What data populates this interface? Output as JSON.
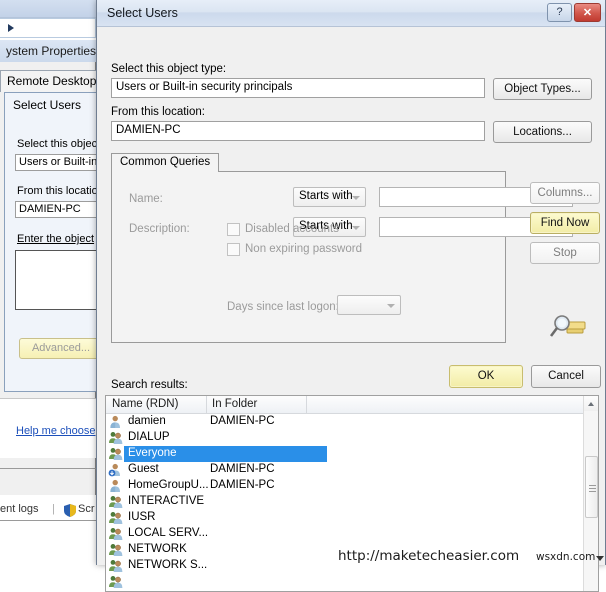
{
  "background": {
    "system_properties_title": "ystem Properties",
    "tab_label": "Remote Desktop",
    "inner_dialog_title": "Select Users",
    "label_object_type": "Select this objec",
    "value_object_type": "Users or Built-in",
    "label_location": "From this location",
    "value_location": "DAMIEN-PC",
    "label_enter_object": "Enter the object",
    "value_enter_object": "",
    "advanced_button": "Advanced...",
    "help_link": "Help me choose",
    "status_text": "ent logs",
    "status_text2": "Scr",
    "shield_icon": "shield-icon"
  },
  "dialog": {
    "title": "Select Users",
    "help_button": "?",
    "close_button": "✕",
    "object_type": {
      "label": "Select this object type:",
      "value": "Users or Built-in security principals",
      "button": "Object Types..."
    },
    "location": {
      "label": "From this location:",
      "value": "DAMIEN-PC",
      "button": "Locations..."
    },
    "tab": {
      "label": "Common Queries"
    },
    "query": {
      "name_label": "Name:",
      "name_operator": "Starts with",
      "name_value": "",
      "description_label": "Description:",
      "description_operator": "Starts with",
      "description_value": "",
      "disabled_accounts_label": "Disabled accounts",
      "disabled_accounts_checked": false,
      "non_expiring_password_label": "Non expiring password",
      "non_expiring_password_checked": false,
      "days_since_logon_label": "Days since last logon:",
      "days_since_logon_value": ""
    },
    "side_buttons": {
      "columns": "Columns...",
      "find_now": "Find Now",
      "stop": "Stop",
      "magnifier_icon": "magnifier-key-icon"
    },
    "footer": {
      "ok": "OK",
      "cancel": "Cancel"
    },
    "results": {
      "label": "Search results:",
      "columns": [
        "Name (RDN)",
        "In Folder"
      ],
      "rows": [
        {
          "name": "damien",
          "folder": "DAMIEN-PC",
          "icon": "user-icon",
          "selected": false
        },
        {
          "name": "DIALUP",
          "folder": "",
          "icon": "group-icon",
          "selected": false
        },
        {
          "name": "Everyone",
          "folder": "",
          "icon": "group-icon",
          "selected": true
        },
        {
          "name": "Guest",
          "folder": "DAMIEN-PC",
          "icon": "user-down-icon",
          "selected": false
        },
        {
          "name": "HomeGroupU...",
          "folder": "DAMIEN-PC",
          "icon": "user-icon",
          "selected": false
        },
        {
          "name": "INTERACTIVE",
          "folder": "",
          "icon": "group-icon",
          "selected": false
        },
        {
          "name": "IUSR",
          "folder": "",
          "icon": "group-icon",
          "selected": false
        },
        {
          "name": "LOCAL SERV...",
          "folder": "",
          "icon": "group-icon",
          "selected": false
        },
        {
          "name": "NETWORK",
          "folder": "",
          "icon": "group-icon",
          "selected": false
        },
        {
          "name": "NETWORK S...",
          "folder": "",
          "icon": "group-icon",
          "selected": false
        },
        {
          "name": "",
          "folder": "",
          "icon": "group-icon",
          "selected": false
        }
      ]
    }
  },
  "watermarks": {
    "primary": "http://maketecheasier.com",
    "secondary": "wsxdn.com"
  },
  "colors": {
    "selection": "#2a8fe8",
    "accent_yellow": "#f2eca6",
    "close_red": "#c13a30",
    "link_blue": "#1c4fba"
  }
}
